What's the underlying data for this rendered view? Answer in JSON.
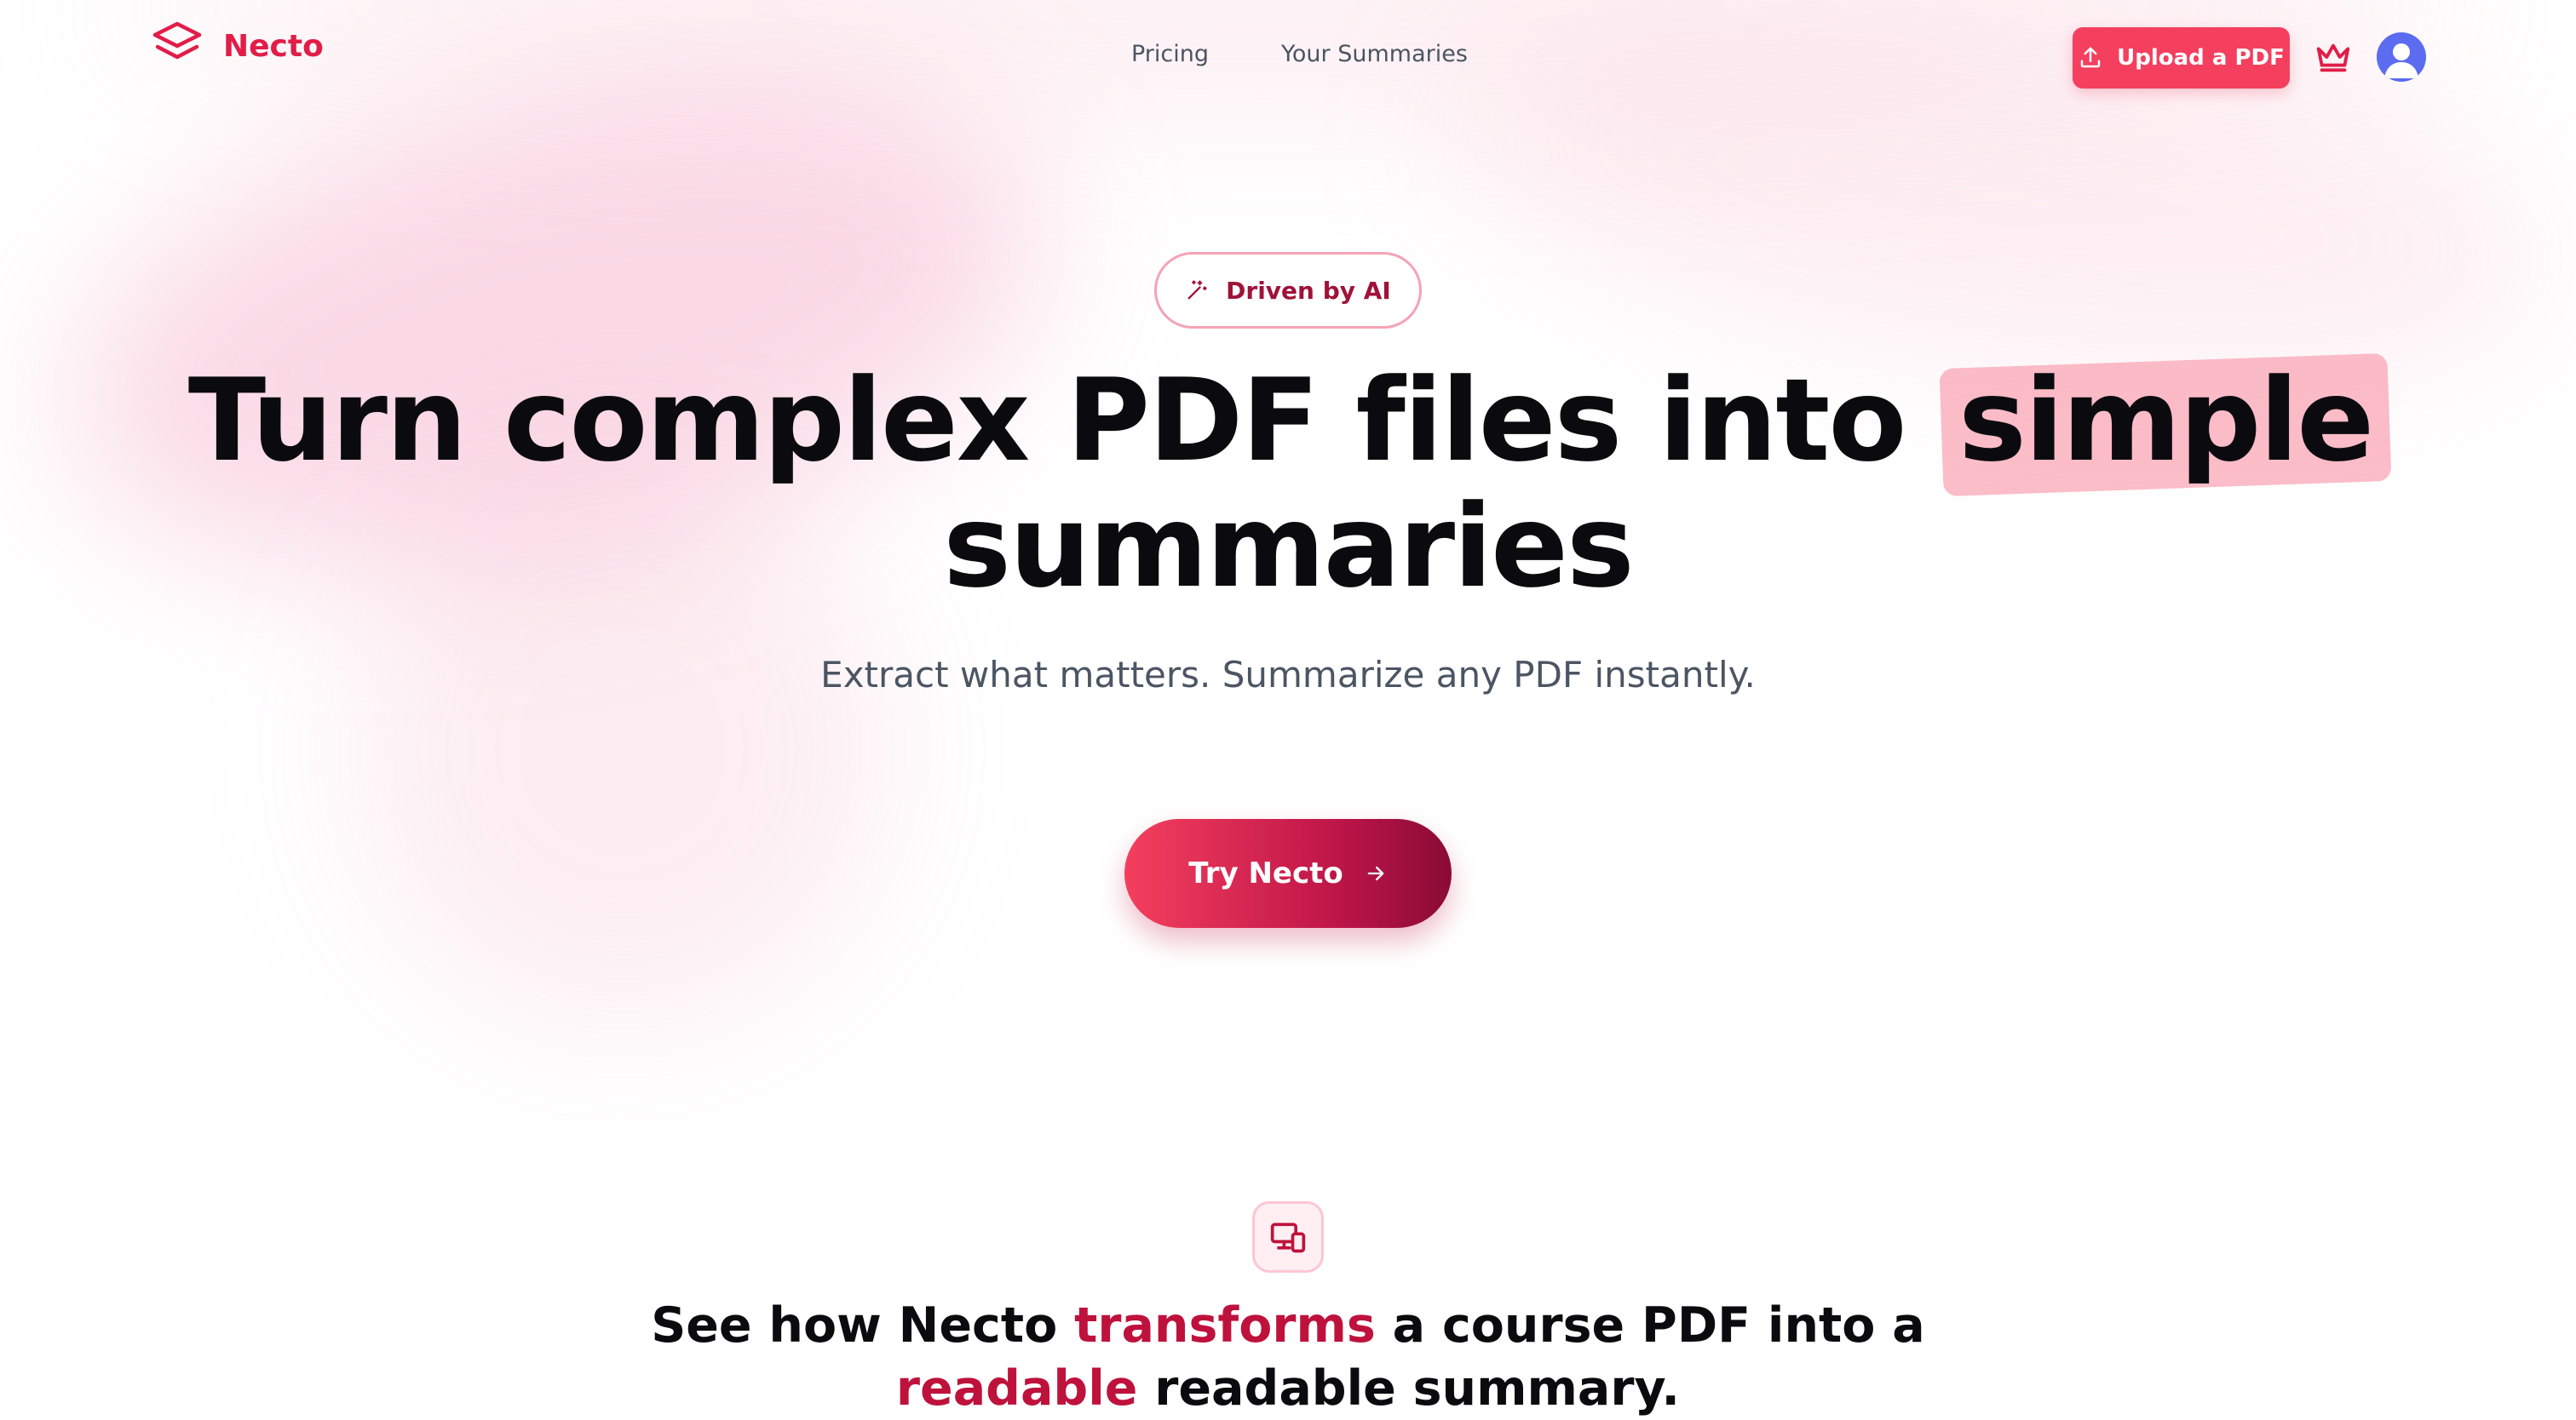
{
  "colors": {
    "accent": "#f43f5e",
    "accent_dark": "#be123c",
    "highlight": "#fbbdc8",
    "text": "#0b0b0f",
    "muted": "#4b5563"
  },
  "brand": {
    "name": "Necto",
    "icon": "layers-icon"
  },
  "nav": {
    "links": [
      {
        "label": "Pricing"
      },
      {
        "label": "Your Summaries"
      }
    ],
    "upload_label": "Upload a PDF",
    "upload_icon": "upload-icon",
    "crown_icon": "crown-icon",
    "avatar_icon": "user-avatar-icon"
  },
  "hero": {
    "badge_label": "Driven by AI",
    "badge_icon": "magic-wand-icon",
    "headline_before": "Turn complex PDF files into",
    "headline_highlight": "simple",
    "headline_after": "summaries",
    "subheading": "Extract what matters. Summarize any PDF instantly.",
    "cta_label": "Try Necto",
    "cta_icon": "arrow-right-icon"
  },
  "features": {
    "icon": "devices-icon",
    "title_part1": "See how Necto",
    "title_accent1": "transforms",
    "title_part2": "a course PDF into a",
    "title_accent2": "readable",
    "title_part3": "readable summary."
  }
}
